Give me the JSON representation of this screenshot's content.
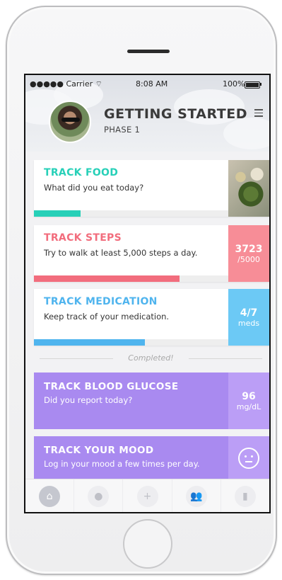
{
  "status_bar": {
    "carrier": "●●●●● Carrier ",
    "wifi": "wifi-icon",
    "time": "8:08 AM",
    "battery": "100%"
  },
  "header": {
    "title": "GETTING STARTED",
    "subtitle": "PHASE 1"
  },
  "cards": [
    {
      "title": "TRACK FOOD",
      "description": "What did you eat today?",
      "color": "#27d0b8",
      "progress": 0.24
    },
    {
      "title": "TRACK STEPS",
      "description": "Try to walk at least 5,000 steps a day.",
      "color": "#f26d7d",
      "progress": 0.75,
      "value": "3723",
      "value_sub": "/5000"
    },
    {
      "title": "TRACK MEDICATION",
      "description": "Keep track of your medication.",
      "color": "#4fb4ee",
      "progress": 0.57,
      "value": "4/7",
      "value_sub": "meds"
    }
  ],
  "completed_label": "Completed!",
  "completed_cards": [
    {
      "title": "TRACK BLOOD GLUCOSE",
      "description": "Did you report today?",
      "value": "96",
      "value_sub": "mg/dL"
    },
    {
      "title": "TRACK YOUR MOOD",
      "description": "Log in your mood a few times per day.",
      "icon": "neutral-face-icon"
    }
  ],
  "tabs": [
    {
      "icon": "home-icon",
      "active": true
    },
    {
      "icon": "bubbles-icon",
      "active": false
    },
    {
      "icon": "plus-icon",
      "active": false
    },
    {
      "icon": "people-icon",
      "active": false
    },
    {
      "icon": "bar-chart-icon",
      "active": false
    }
  ],
  "colors": {
    "purple_card": "#a98af0",
    "purple_side": "#bb9ef6",
    "steps_side": "#f78d97",
    "meds_side": "#6cc9f5"
  }
}
